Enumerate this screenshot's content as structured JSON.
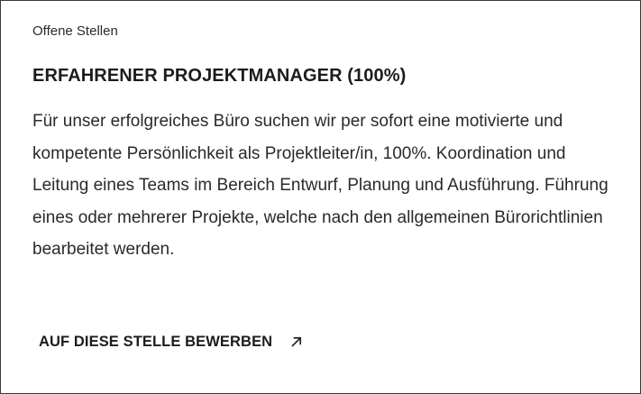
{
  "job": {
    "category": "Offene Stellen",
    "title": "ERFAHRENER PROJEKTMANAGER (100%)",
    "description": "Für unser erfolgreiches Büro suchen wir per sofort eine motivierte und kompetente Persönlichkeit als Projektleiter/in, 100%. Koordination und Leitung eines Teams im Bereich Entwurf, Planung und Ausführung. Führung eines oder mehrerer Projekte, welche nach den allgemeinen Bürorichtlinien bearbeitet werden.",
    "apply_label": "AUF DIESE STELLE BEWERBEN",
    "apply_icon": "arrow-up-right-icon"
  },
  "colors": {
    "border": "#3a3a3a",
    "text": "#1f1f1f",
    "background": "#ffffff"
  }
}
